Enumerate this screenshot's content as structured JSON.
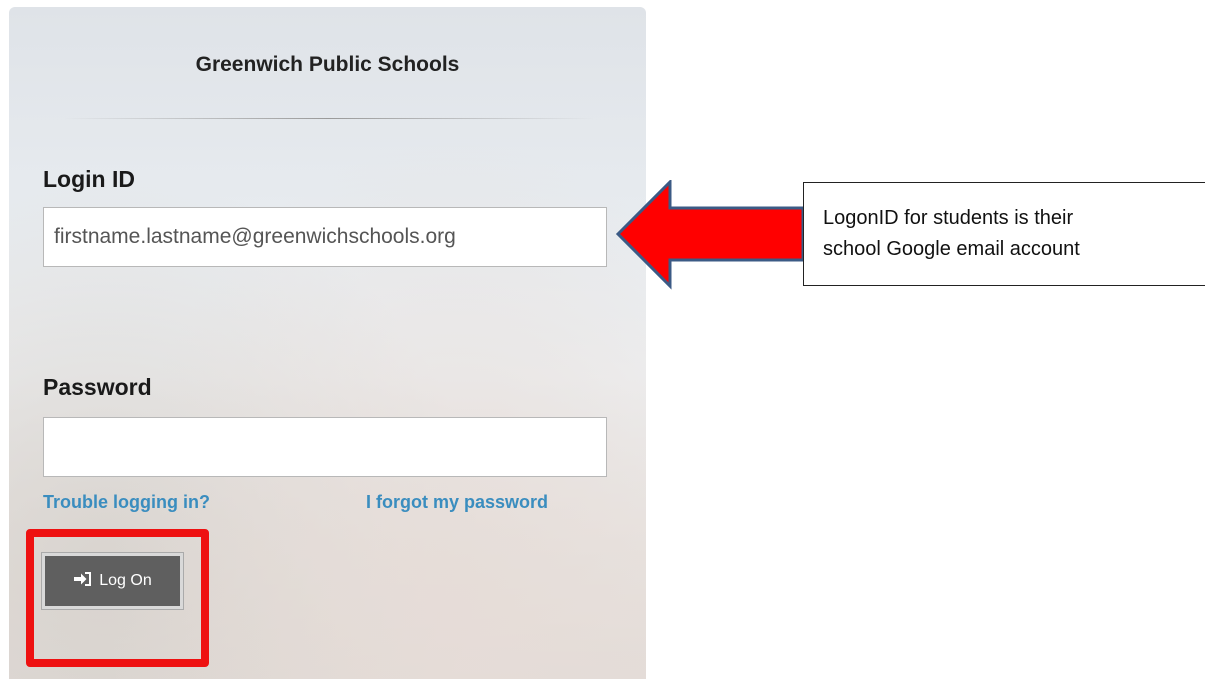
{
  "login": {
    "school_name": "Greenwich Public Schools",
    "login_id_label": "Login ID",
    "login_id_value": "firstname.lastname@greenwichschools.org",
    "password_label": "Password",
    "password_value": "",
    "trouble_link": "Trouble logging in?",
    "forgot_link": "I forgot my password",
    "logon_button": "Log On",
    "logon_icon": "sign-in-icon"
  },
  "annotation": {
    "line1": "LogonID for students is their",
    "line2": "school Google email account",
    "arrow_color": "#ff0000",
    "arrow_outline": "#3b5a85",
    "highlight_color": "#ee1111"
  }
}
